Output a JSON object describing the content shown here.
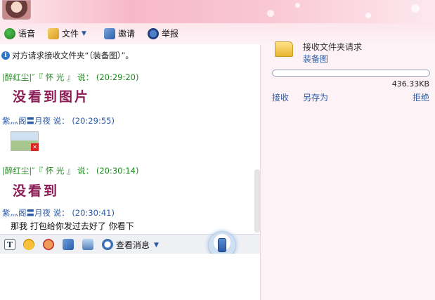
{
  "toolbar": {
    "voice_label": "语音",
    "file_label": "文件",
    "invite_label": "邀请",
    "report_label": "举报"
  },
  "chat": {
    "info_text": "对方请求接收文件夹“（装备图）”。",
    "messages": [
      {
        "sender": "|醉红尘|″『  怀 光  』 说：",
        "time": "(20:29:20)",
        "content": "没看到图片"
      },
      {
        "sender": "紫灬阁〓月夜 说：",
        "time": "(20:29:55)",
        "content": ""
      },
      {
        "sender": "|醉红尘|″『  怀 光  』 说：",
        "time": "(20:30:14)",
        "content": "没看到"
      },
      {
        "sender": "紫灬阁〓月夜 说：",
        "time": "(20:30:41)",
        "content": "那我 打包给你发过去好了 你看下"
      }
    ]
  },
  "input_toolbar": {
    "view_messages_label": "查看消息"
  },
  "transfer": {
    "title": "接收文件夹请求",
    "folder_name": "装备图",
    "size": "436.33KB",
    "progress": 0,
    "accept_label": "接收",
    "save_as_label": "另存为",
    "reject_label": "拒绝"
  }
}
